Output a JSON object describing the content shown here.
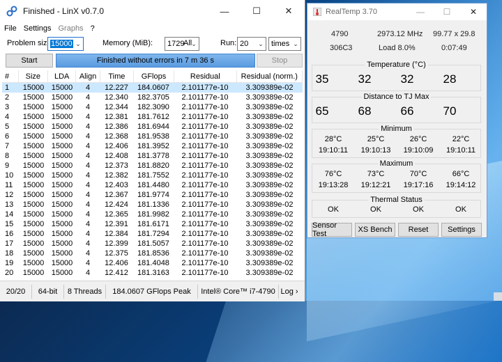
{
  "linx": {
    "title": "Finished - LinX v0.7.0",
    "menu": [
      "File",
      "Settings",
      "Graphs",
      "?"
    ],
    "problem_size_label": "Problem size:",
    "problem_size_value": "15000",
    "memory_label": "Memory (MiB):",
    "memory_value": "1729",
    "memory_all": "All",
    "run_label": "Run:",
    "run_value": "20",
    "run_unit": "times",
    "start_label": "Start",
    "status_text": "Finished without errors in 7 m 36 s",
    "stop_label": "Stop",
    "columns": [
      "#",
      "Size",
      "LDA",
      "Align",
      "Time",
      "GFlops",
      "Residual",
      "Residual (norm.)"
    ],
    "rows": [
      [
        "1",
        "15000",
        "15000",
        "4",
        "12.227",
        "184.0607",
        "2.101177e-10",
        "3.309389e-02"
      ],
      [
        "2",
        "15000",
        "15000",
        "4",
        "12.340",
        "182.3705",
        "2.101177e-10",
        "3.309389e-02"
      ],
      [
        "3",
        "15000",
        "15000",
        "4",
        "12.344",
        "182.3090",
        "2.101177e-10",
        "3.309389e-02"
      ],
      [
        "4",
        "15000",
        "15000",
        "4",
        "12.381",
        "181.7612",
        "2.101177e-10",
        "3.309389e-02"
      ],
      [
        "5",
        "15000",
        "15000",
        "4",
        "12.386",
        "181.6944",
        "2.101177e-10",
        "3.309389e-02"
      ],
      [
        "6",
        "15000",
        "15000",
        "4",
        "12.368",
        "181.9538",
        "2.101177e-10",
        "3.309389e-02"
      ],
      [
        "7",
        "15000",
        "15000",
        "4",
        "12.406",
        "181.3952",
        "2.101177e-10",
        "3.309389e-02"
      ],
      [
        "8",
        "15000",
        "15000",
        "4",
        "12.408",
        "181.3778",
        "2.101177e-10",
        "3.309389e-02"
      ],
      [
        "9",
        "15000",
        "15000",
        "4",
        "12.373",
        "181.8820",
        "2.101177e-10",
        "3.309389e-02"
      ],
      [
        "10",
        "15000",
        "15000",
        "4",
        "12.382",
        "181.7552",
        "2.101177e-10",
        "3.309389e-02"
      ],
      [
        "11",
        "15000",
        "15000",
        "4",
        "12.403",
        "181.4480",
        "2.101177e-10",
        "3.309389e-02"
      ],
      [
        "12",
        "15000",
        "15000",
        "4",
        "12.367",
        "181.9774",
        "2.101177e-10",
        "3.309389e-02"
      ],
      [
        "13",
        "15000",
        "15000",
        "4",
        "12.424",
        "181.1336",
        "2.101177e-10",
        "3.309389e-02"
      ],
      [
        "14",
        "15000",
        "15000",
        "4",
        "12.365",
        "181.9982",
        "2.101177e-10",
        "3.309389e-02"
      ],
      [
        "15",
        "15000",
        "15000",
        "4",
        "12.391",
        "181.6171",
        "2.101177e-10",
        "3.309389e-02"
      ],
      [
        "16",
        "15000",
        "15000",
        "4",
        "12.384",
        "181.7294",
        "2.101177e-10",
        "3.309389e-02"
      ],
      [
        "17",
        "15000",
        "15000",
        "4",
        "12.399",
        "181.5057",
        "2.101177e-10",
        "3.309389e-02"
      ],
      [
        "18",
        "15000",
        "15000",
        "4",
        "12.375",
        "181.8536",
        "2.101177e-10",
        "3.309389e-02"
      ],
      [
        "19",
        "15000",
        "15000",
        "4",
        "12.406",
        "181.4048",
        "2.101177e-10",
        "3.309389e-02"
      ],
      [
        "20",
        "15000",
        "15000",
        "4",
        "12.412",
        "181.3163",
        "2.101177e-10",
        "3.309389e-02"
      ]
    ],
    "statusbar": [
      "20/20",
      "64-bit",
      "8 Threads",
      "184.0607 GFlops Peak",
      "Intel® Core™ i7-4790",
      "Log ›"
    ]
  },
  "realtemp": {
    "title": "RealTemp 3.70",
    "cpu_id": "4790",
    "frequency": "2973.12 MHz",
    "multiplier": "99.77 x 29.8",
    "stepping": "306C3",
    "load": "Load  8.0%",
    "uptime": "0:07:49",
    "temperature_title": "Temperature (°C)",
    "temperatures": [
      "35",
      "32",
      "32",
      "28"
    ],
    "distance_title": "Distance to TJ Max",
    "distances": [
      "65",
      "68",
      "66",
      "70"
    ],
    "minimum_title": "Minimum",
    "minimum_temps": [
      "28°C",
      "25°C",
      "26°C",
      "22°C"
    ],
    "minimum_times": [
      "19:10:11",
      "19:10:13",
      "19:10:09",
      "19:10:11"
    ],
    "maximum_title": "Maximum",
    "maximum_temps": [
      "76°C",
      "73°C",
      "70°C",
      "66°C"
    ],
    "maximum_times": [
      "19:13:28",
      "19:12:21",
      "19:17:16",
      "19:14:12"
    ],
    "thermal_title": "Thermal Status",
    "thermal_status": [
      "OK",
      "OK",
      "OK",
      "OK"
    ],
    "buttons": [
      "Sensor Test",
      "XS Bench",
      "Reset",
      "Settings"
    ]
  }
}
